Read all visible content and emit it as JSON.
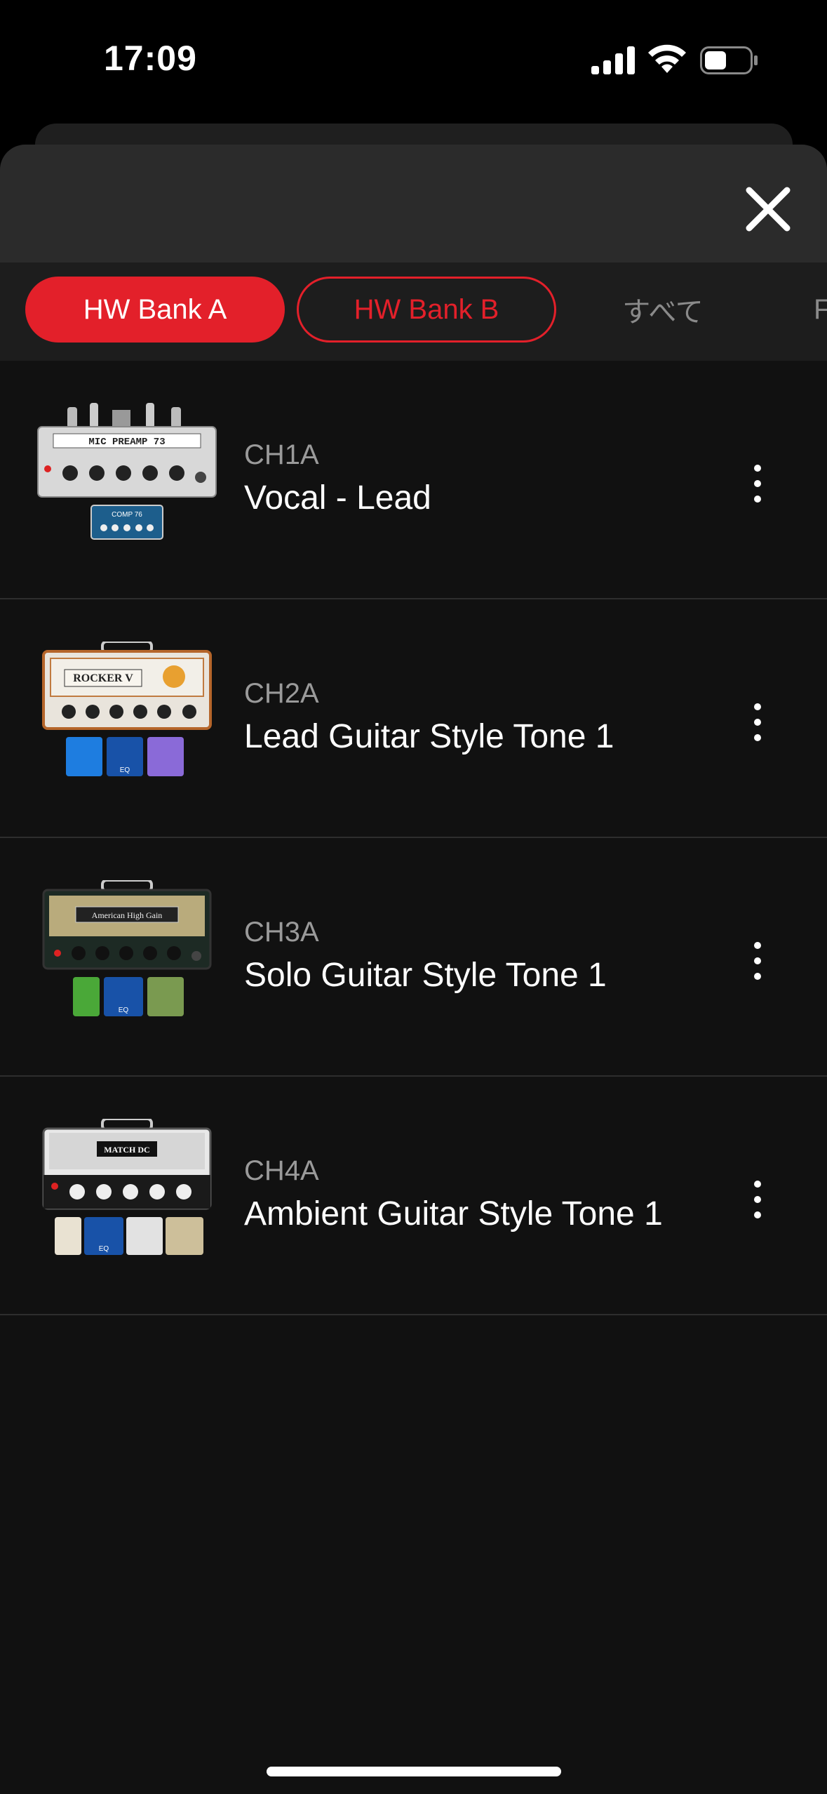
{
  "status_bar": {
    "time": "17:09"
  },
  "tabs": [
    {
      "label": "HW Bank A",
      "selected": true
    },
    {
      "label": "HW Bank B",
      "selected": false
    },
    {
      "label": "すべて",
      "selected": false
    },
    {
      "label": "F",
      "selected": false
    }
  ],
  "presets": [
    {
      "channel": "CH1A",
      "name": "Vocal - Lead",
      "amp_label": "MIC PREAMP 73",
      "pedal_label": "COMP 76"
    },
    {
      "channel": "CH2A",
      "name": "Lead Guitar Style Tone 1",
      "amp_label": "ROCKER V",
      "pedal_label": "EQ"
    },
    {
      "channel": "CH3A",
      "name": "Solo Guitar Style Tone 1",
      "amp_label": "American High Gain",
      "pedal_label": "EQ"
    },
    {
      "channel": "CH4A",
      "name": "Ambient Guitar Style Tone 1",
      "amp_label": "MATCH DC",
      "pedal_label": "EQ"
    }
  ],
  "icons": {
    "close": "close-icon",
    "more": "more-vertical-icon"
  },
  "colors": {
    "accent": "#e3202a",
    "background": "#111111",
    "header": "#2b2b2b"
  }
}
